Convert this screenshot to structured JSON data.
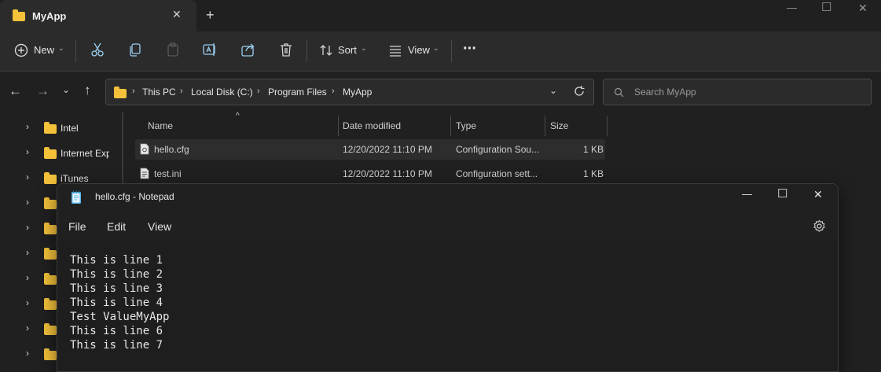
{
  "explorer": {
    "tab_title": "MyApp",
    "new_tab_label": "+",
    "window_controls": {
      "minimize": "—",
      "maximize": "☐",
      "close": "✕"
    },
    "toolbar": {
      "new_label": "New",
      "sort_label": "Sort",
      "view_label": "View",
      "more_label": "···"
    },
    "breadcrumb": [
      "This PC",
      "Local Disk (C:)",
      "Program Files",
      "MyApp"
    ],
    "search_placeholder": "Search MyApp",
    "sidebar_items": [
      "Intel",
      "Internet Exp",
      "iTunes",
      "",
      "",
      "",
      "",
      "",
      "",
      ""
    ],
    "columns": {
      "name": "Name",
      "date": "Date modified",
      "type": "Type",
      "size": "Size"
    },
    "files": [
      {
        "name": "hello.cfg",
        "date": "12/20/2022 11:10 PM",
        "type": "Configuration Sou...",
        "size": "1 KB"
      },
      {
        "name": "test.ini",
        "date": "12/20/2022 11:10 PM",
        "type": "Configuration sett...",
        "size": "1 KB"
      }
    ]
  },
  "notepad": {
    "title": "hello.cfg - Notepad",
    "window_controls": {
      "minimize": "—",
      "maximize": "☐",
      "close": "✕"
    },
    "menu": [
      "File",
      "Edit",
      "View"
    ],
    "lines": [
      "This is line 1",
      "This is line 2",
      "This is line 3",
      "This is line 4",
      "Test ValueMyApp",
      "This is line 6",
      "This is line 7"
    ]
  },
  "colors": {
    "folder": "#f3c13a",
    "accent": "#4cc2ff",
    "background": "#202020",
    "surface": "#2b2b2b"
  },
  "icons": [
    "folder-icon",
    "plus-circle-icon",
    "cut-icon",
    "copy-icon",
    "paste-icon",
    "rename-icon",
    "share-icon",
    "delete-icon",
    "sort-icon",
    "view-icon",
    "more-icon",
    "back-arrow-icon",
    "forward-arrow-icon",
    "up-arrow-icon",
    "refresh-icon",
    "search-icon",
    "notepad-icon",
    "gear-icon"
  ]
}
